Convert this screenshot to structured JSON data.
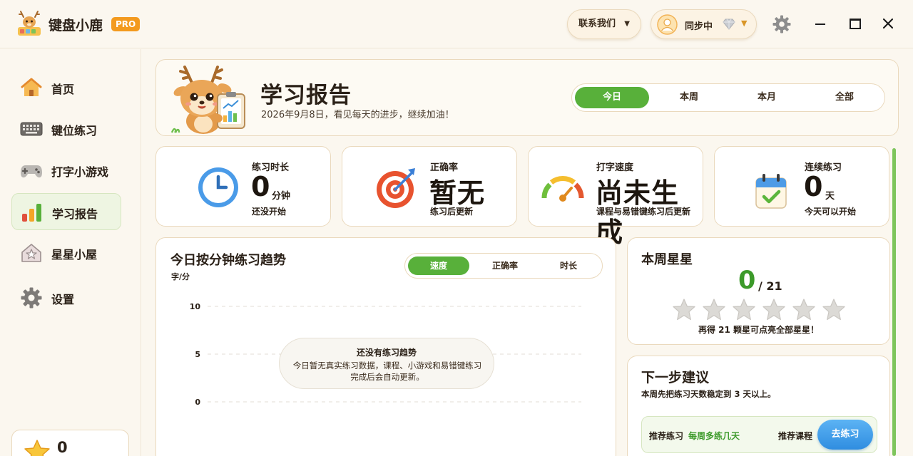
{
  "app": {
    "name": "键盘小鹿",
    "badge": "PRO"
  },
  "titlebar": {
    "contact_label": "联系我们",
    "sync_label": "同步中"
  },
  "sidebar": {
    "items": [
      {
        "label": "首页",
        "icon": "house-icon"
      },
      {
        "label": "键位练习",
        "icon": "keyboard-icon"
      },
      {
        "label": "打字小游戏",
        "icon": "gamepad-icon"
      },
      {
        "label": "学习报告",
        "icon": "bar-chart-icon",
        "active": true
      },
      {
        "label": "星星小屋",
        "icon": "star-house-icon"
      },
      {
        "label": "设置",
        "icon": "gear-icon"
      }
    ],
    "star_count": "0"
  },
  "header": {
    "title": "学习报告",
    "subtitle": "2026年9月8日，看见每天的进步，继续加油！",
    "tabs": [
      "今日",
      "本周",
      "本月",
      "全部"
    ],
    "active_tab": "今日"
  },
  "stats": [
    {
      "label": "练习时长",
      "value": "0",
      "unit": "分钟",
      "note": "还没开始",
      "icon": "clock-icon"
    },
    {
      "label": "正确率",
      "value": "暂无",
      "unit": "",
      "note": "练习后更新",
      "icon": "target-icon"
    },
    {
      "label": "打字速度",
      "value": "尚未生成",
      "unit": "",
      "note": "课程与易错键练习后更新",
      "icon": "speedometer-icon"
    },
    {
      "label": "连续练习",
      "value": "0",
      "unit": "天",
      "note": "今天可以开始",
      "icon": "calendar-check-icon"
    }
  ],
  "trend": {
    "title": "今日按分钟练习趋势",
    "unit": "字/分",
    "tabs": [
      "速度",
      "正确率",
      "时长"
    ],
    "active_tab": "速度",
    "empty_title": "还没有练习趋势",
    "empty_desc": "今日暂无真实练习数据，课程、小游戏和易错键练习完成后会自动更新。"
  },
  "chart_data": {
    "type": "line",
    "ylabel": "字/分",
    "ylim": [
      0,
      10
    ],
    "yticks": [
      "10",
      "5",
      "0"
    ],
    "series": []
  },
  "weekly_stars": {
    "title": "本周星星",
    "earned": "0",
    "total": "/ 21",
    "star_slots": 6,
    "message": "再得 21 颗星可点亮全部星星！"
  },
  "next_steps": {
    "title": "下一步建议",
    "subtitle": "本周先把练习天数稳定到 3 天以上。",
    "rec_label": "推荐练习",
    "rec_value": "每周多练几天",
    "course_label": "推荐课程",
    "button_label": "去练习"
  },
  "colors": {
    "accent_green": "#58b03a",
    "button_blue": "#2f8de0",
    "brand_orange": "#f39a1e"
  }
}
